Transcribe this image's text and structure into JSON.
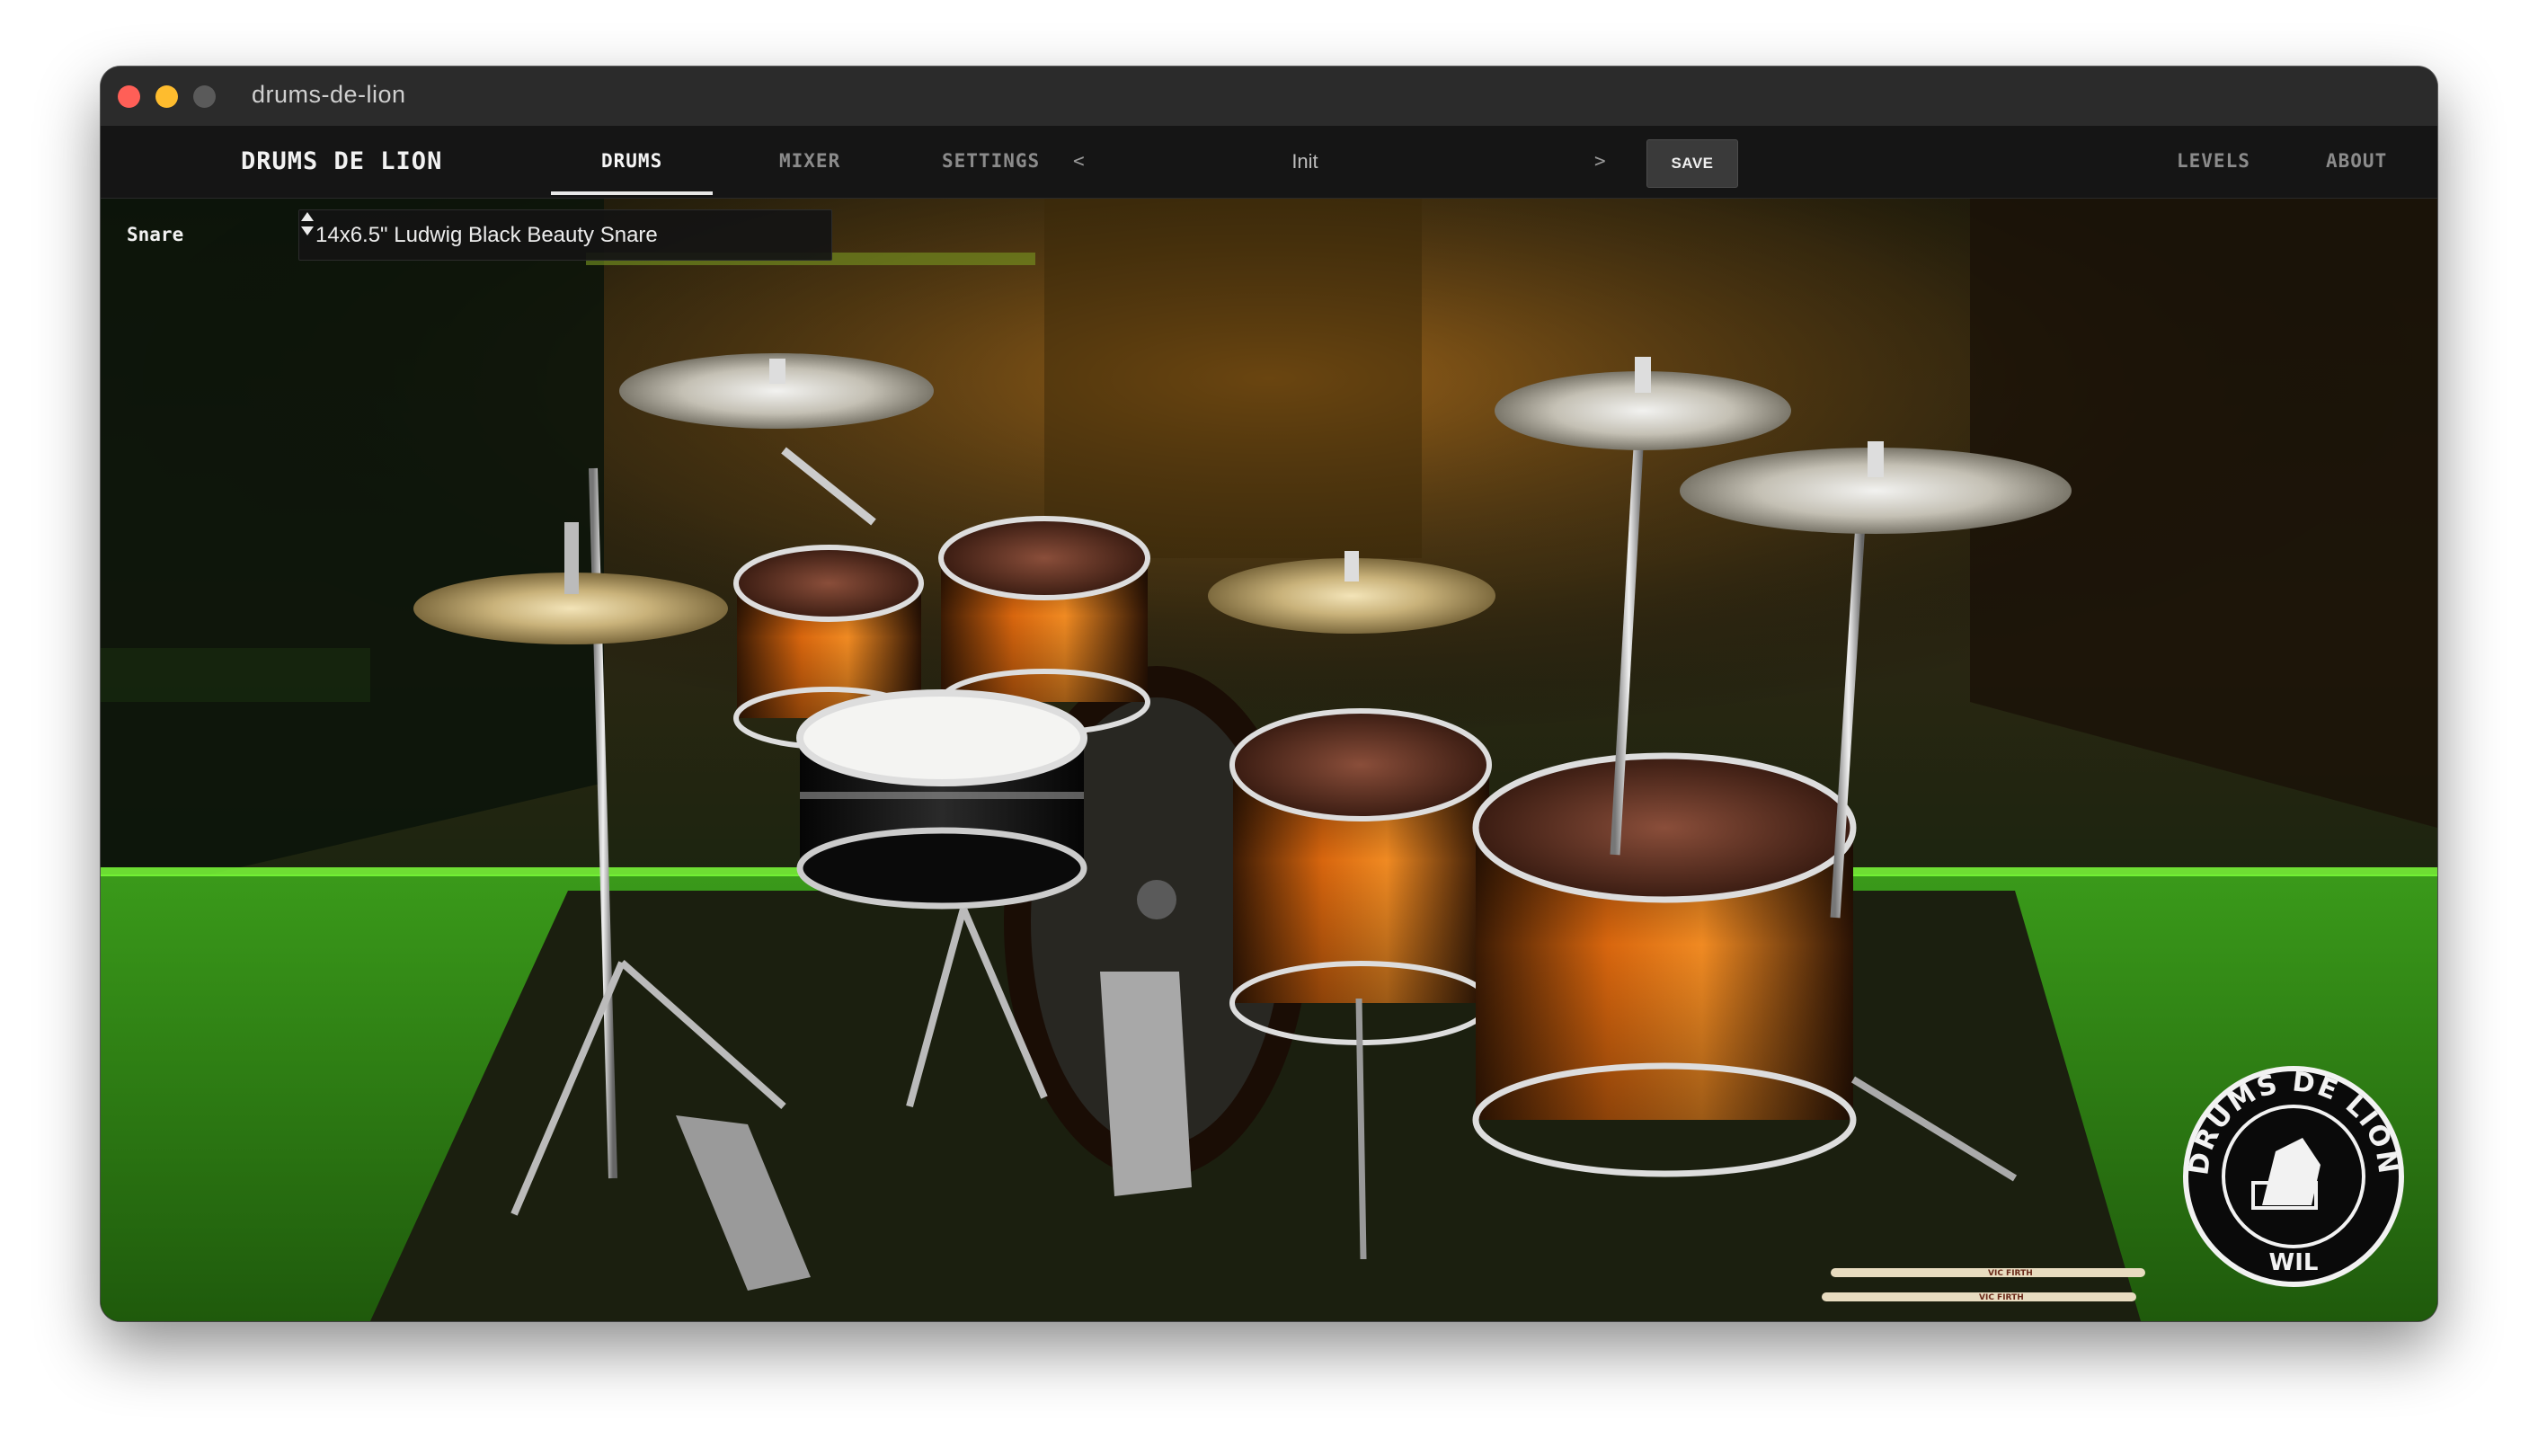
{
  "window": {
    "title": "drums-de-lion"
  },
  "nav": {
    "brand": "DRUMS DE LION",
    "tabs": [
      {
        "label": "DRUMS",
        "active": true
      },
      {
        "label": "MIXER",
        "active": false
      },
      {
        "label": "SETTINGS",
        "active": false
      }
    ],
    "preset": {
      "prev": "<",
      "name": "Init",
      "next": ">"
    },
    "save_label": "SAVE",
    "right_links": [
      "LEVELS",
      "ABOUT"
    ]
  },
  "kit": {
    "piece_label": "Snare",
    "selected_piece": "14x6.5\" Ludwig Black Beauty Snare"
  },
  "logo": {
    "top_text": "DRUMS DE LION",
    "bottom_text": "WIL"
  },
  "sticks": {
    "brand": "VIC FIRTH"
  },
  "colors": {
    "nav_bg": "#151515",
    "titlebar_bg": "#2b2b2b",
    "floor_green": "#3e9c1e",
    "shell_orange": "#d96b10"
  }
}
